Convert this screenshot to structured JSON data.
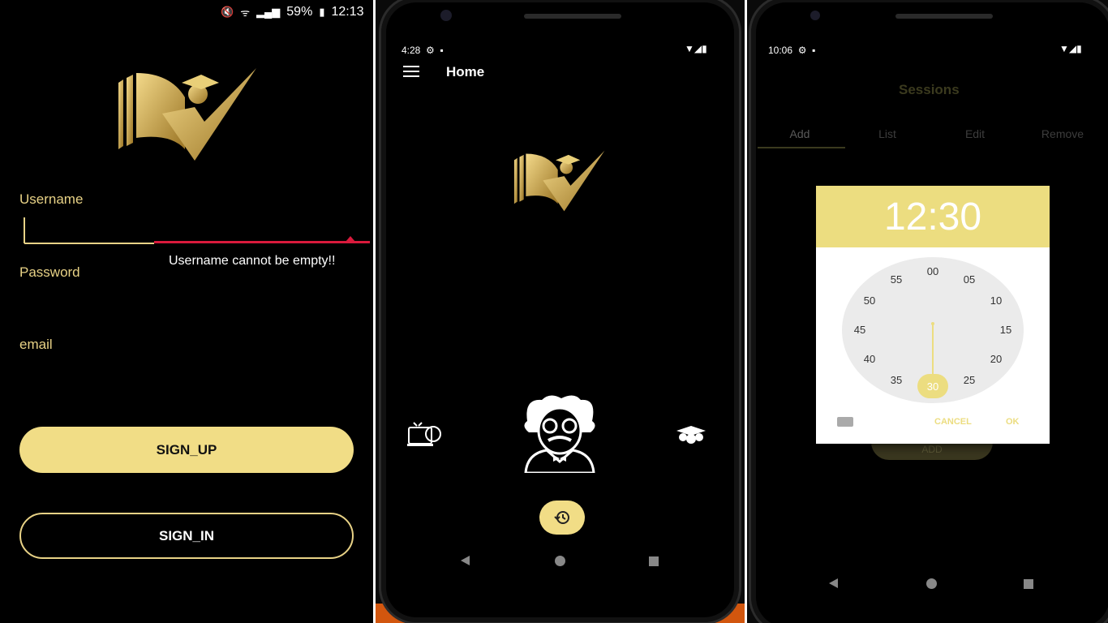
{
  "login": {
    "status": {
      "battery": "59%",
      "time": "12:13"
    },
    "username_label": "Username",
    "error_text": "Username cannot be empty!!",
    "password_label": "Password",
    "email_label": "email",
    "signup_label": "SIGN_UP",
    "signin_label": "SIGN_IN"
  },
  "home": {
    "status": {
      "time": "4:28"
    },
    "title": "Home"
  },
  "sessions": {
    "status": {
      "time": "10:06"
    },
    "title": "Sessions",
    "tabs": [
      "Add",
      "List",
      "Edit",
      "Remove"
    ],
    "add_button_label": "ADD",
    "time_picker": {
      "time": "12:30",
      "minutes": [
        "00",
        "05",
        "10",
        "15",
        "20",
        "25",
        "30",
        "35",
        "40",
        "45",
        "50",
        "55"
      ],
      "selected_minute": "30",
      "cancel_label": "CANCEL",
      "ok_label": "OK"
    }
  },
  "colors": {
    "accent": "#f1dd86",
    "background": "#000000",
    "error": "#d91a3c"
  }
}
